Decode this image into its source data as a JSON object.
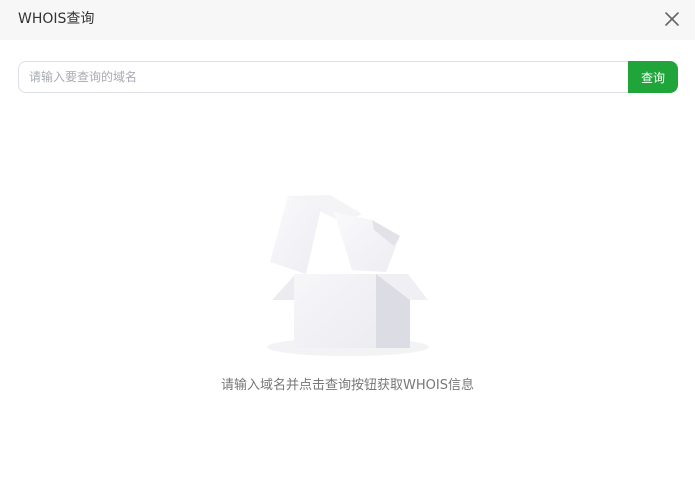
{
  "dialog": {
    "title": "WHOIS查询"
  },
  "search": {
    "placeholder": "请输入要查询的域名",
    "value": "",
    "button_label": "查询",
    "button_color": "#20a53a"
  },
  "empty_state": {
    "icon": "empty-box-icon",
    "message": "请输入域名并点击查询按钮获取WHOIS信息"
  },
  "icons": {
    "close": "close-icon"
  }
}
